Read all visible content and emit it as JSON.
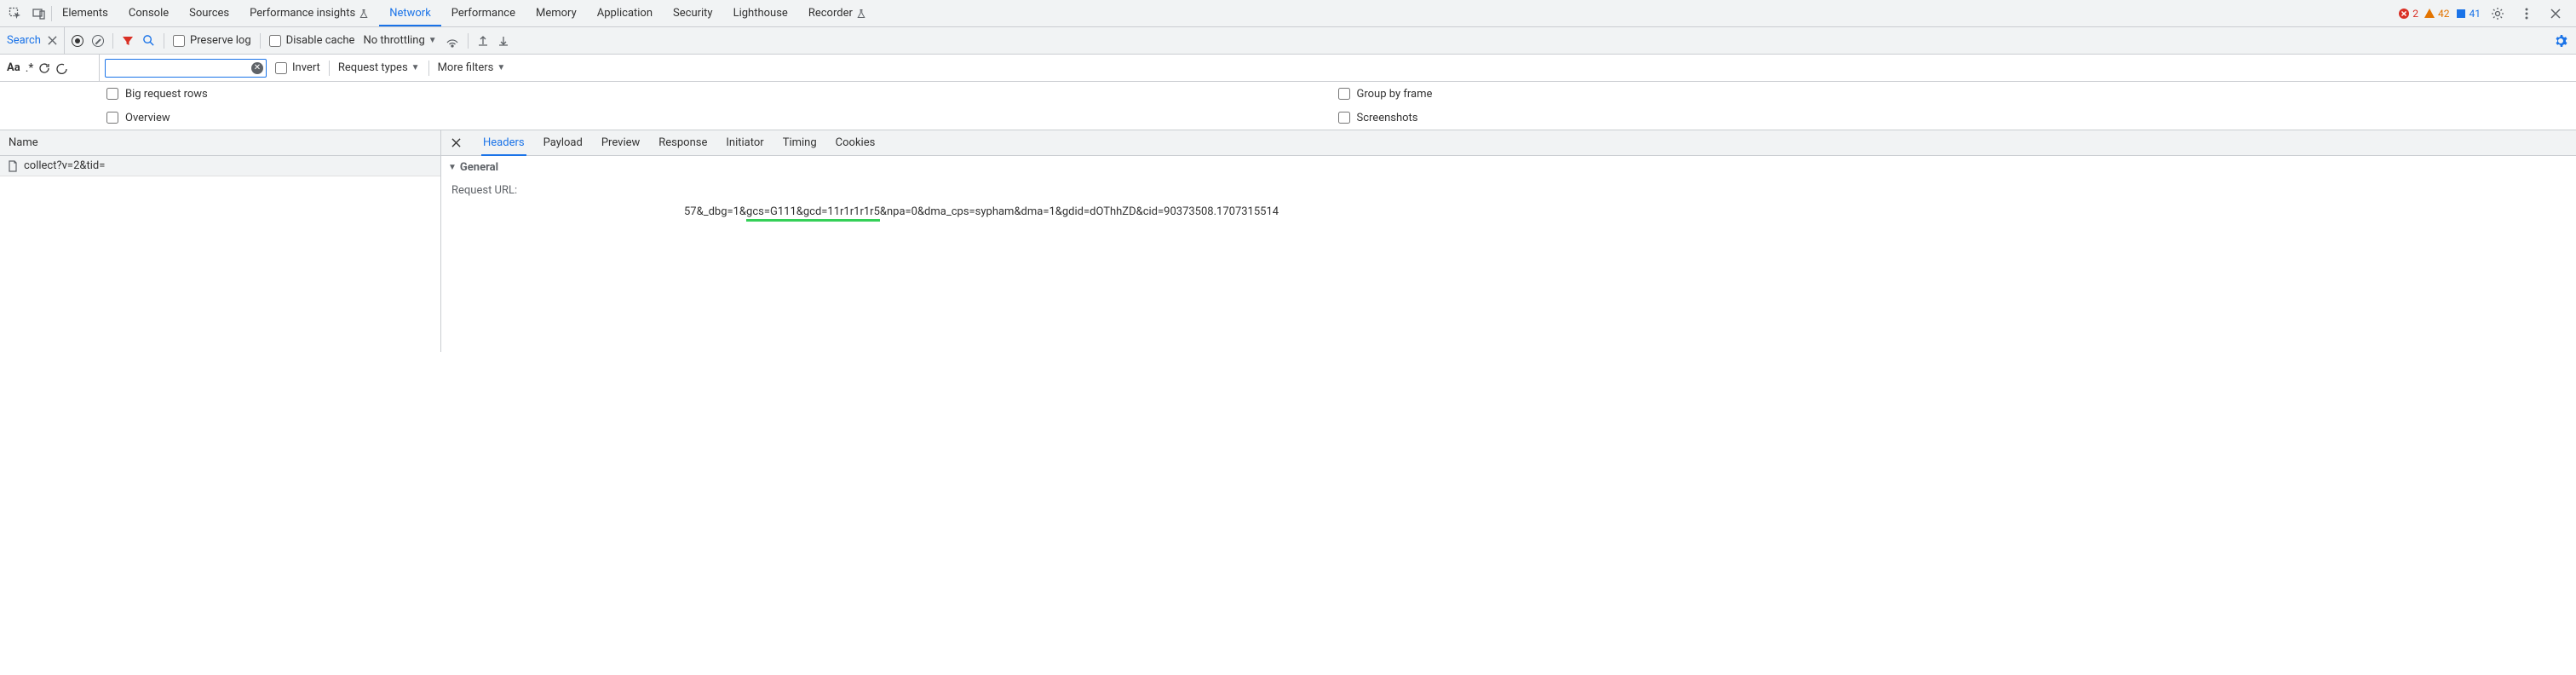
{
  "mainTabs": {
    "elements": "Elements",
    "console": "Console",
    "sources": "Sources",
    "performanceInsights": "Performance insights",
    "network": "Network",
    "performance": "Performance",
    "memory": "Memory",
    "application": "Application",
    "security": "Security",
    "lighthouse": "Lighthouse",
    "recorder": "Recorder"
  },
  "badges": {
    "errors": "2",
    "warnings": "42",
    "issues": "41"
  },
  "searchPanel": {
    "label": "Search"
  },
  "netToolbar": {
    "preserveLog": "Preserve log",
    "disableCache": "Disable cache",
    "throttling": "No throttling"
  },
  "searchTools": {
    "aa": "Aa",
    "regex": ".*"
  },
  "filterBar": {
    "invert": "Invert",
    "requestTypes": "Request types",
    "moreFilters": "More filters"
  },
  "options": {
    "bigRequestRows": "Big request rows",
    "groupByFrame": "Group by frame",
    "overview": "Overview",
    "screenshots": "Screenshots"
  },
  "nameColumn": {
    "header": "Name",
    "row1": "collect?v=2&tid="
  },
  "detailTabs": {
    "headers": "Headers",
    "payload": "Payload",
    "preview": "Preview",
    "response": "Response",
    "initiator": "Initiator",
    "timing": "Timing",
    "cookies": "Cookies"
  },
  "general": {
    "sectionTitle": "General",
    "requestUrlLabel": "Request URL:",
    "urlPart1": "57&_dbg=1&",
    "urlHighlighted": "gcs=G111&gcd=11r1r1r1r5",
    "urlPart2": "&npa=0&dma_cps=sypham&dma=1&gdid=dOThhZD&cid=90373508.1707315514"
  }
}
